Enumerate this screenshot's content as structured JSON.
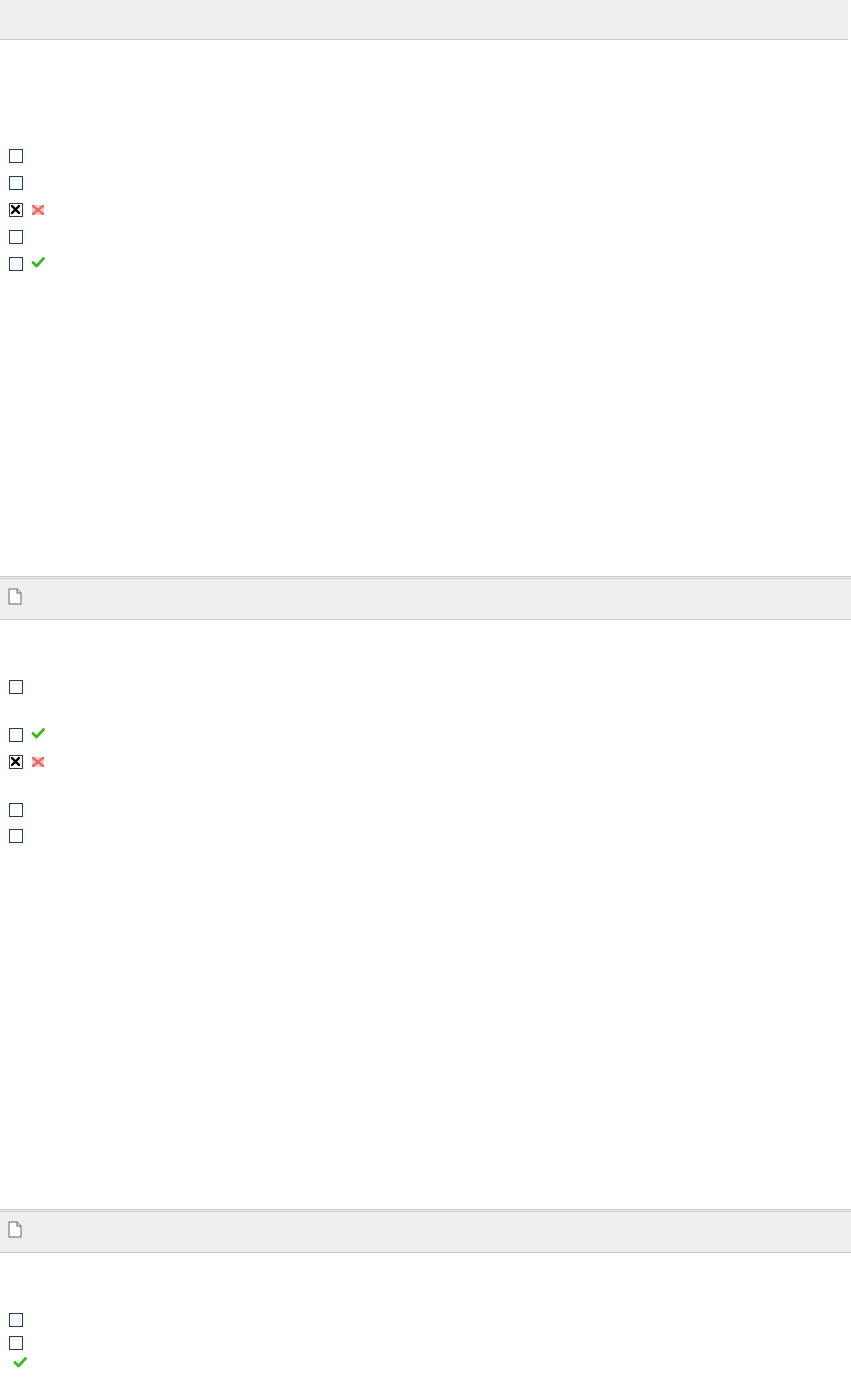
{
  "sections": [
    {
      "header_icon": "",
      "items": [
        {
          "checked": false,
          "result": ""
        },
        {
          "checked": false,
          "result": ""
        },
        {
          "checked": true,
          "result": "wrong-x-icon"
        },
        {
          "checked": false,
          "result": ""
        },
        {
          "checked": false,
          "result": "correct-check-icon"
        }
      ]
    },
    {
      "header_icon": "document-icon",
      "items": [
        {
          "checked": false,
          "result": ""
        },
        {
          "checked": false,
          "result": "correct-check-icon"
        },
        {
          "checked": true,
          "result": "wrong-x-icon"
        },
        {
          "checked": false,
          "result": ""
        },
        {
          "checked": false,
          "result": ""
        }
      ]
    },
    {
      "header_icon": "document-icon",
      "items": [
        {
          "checked": false,
          "result": ""
        },
        {
          "checked": false,
          "result": "correct-check-icon"
        }
      ]
    }
  ],
  "colors": {
    "header_bg": "#eeeeee",
    "checkbox_border": "#1f3f6e",
    "correct_green": "#3cb81e",
    "wrong_red": "#e06a6a"
  }
}
